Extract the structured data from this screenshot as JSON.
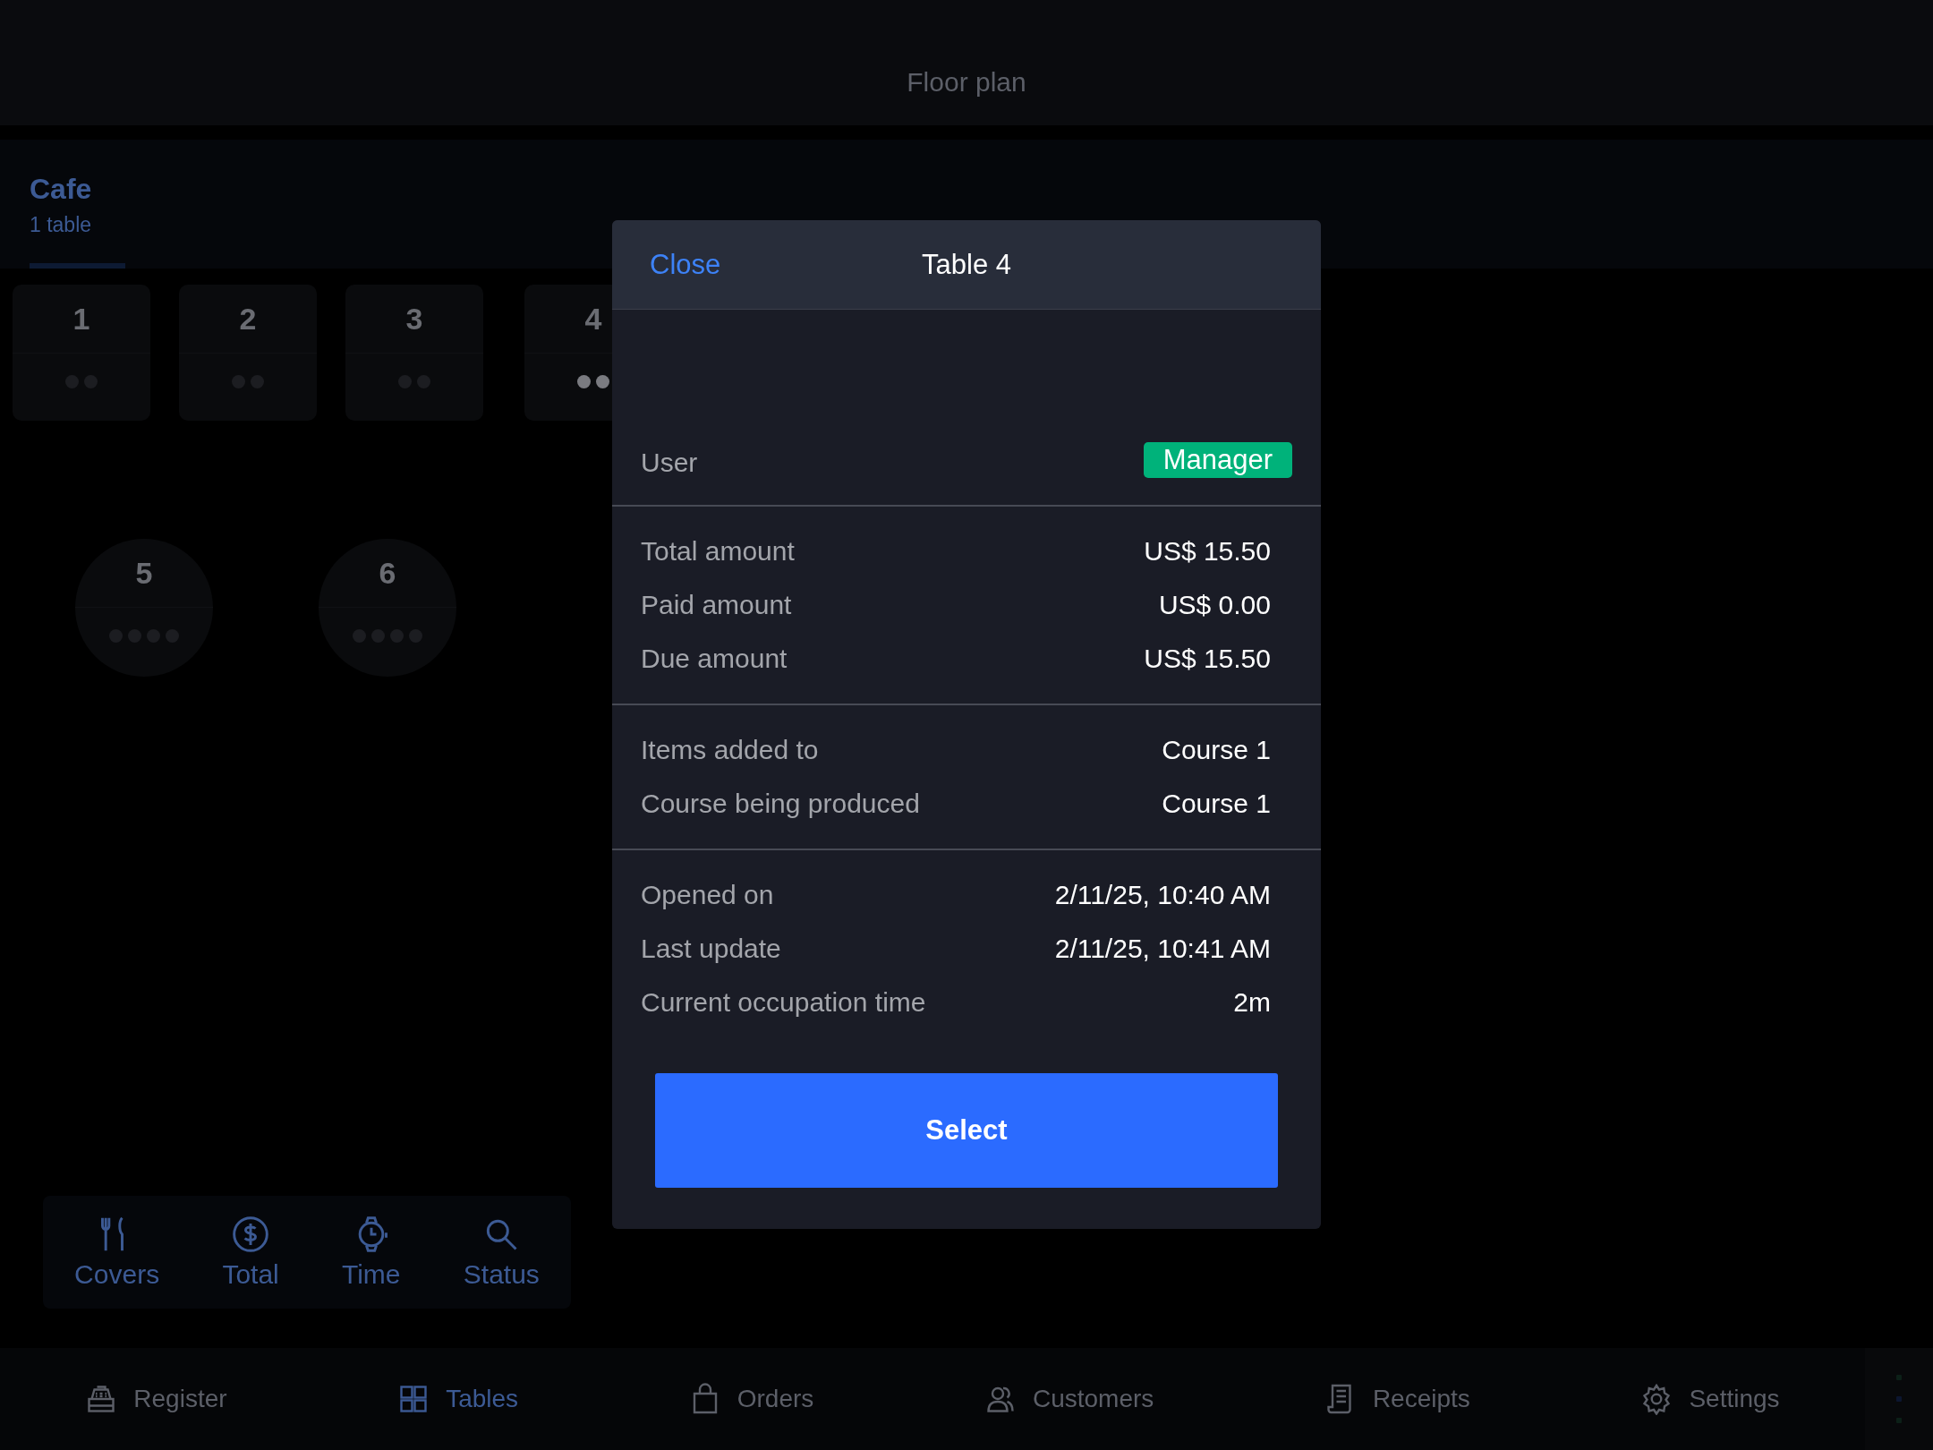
{
  "header": {
    "title": "Floor plan"
  },
  "sections": [
    {
      "name": "Cafe",
      "count": "1 table",
      "selected": true
    }
  ],
  "tables": [
    {
      "number": "1",
      "kind": "square",
      "occupied": false
    },
    {
      "number": "2",
      "kind": "square",
      "occupied": false
    },
    {
      "number": "3",
      "kind": "square",
      "occupied": false
    },
    {
      "number": "4",
      "kind": "square",
      "occupied": true
    },
    {
      "number": "5",
      "kind": "round",
      "occupied": false
    },
    {
      "number": "6",
      "kind": "round",
      "occupied": false
    }
  ],
  "filters": [
    {
      "label": "Covers",
      "kind": "covers"
    },
    {
      "label": "Total",
      "kind": "total"
    },
    {
      "label": "Time",
      "kind": "time"
    },
    {
      "label": "Status",
      "kind": "status"
    }
  ],
  "nav": [
    {
      "label": "Register",
      "kind": "register",
      "selected": false
    },
    {
      "label": "Tables",
      "kind": "tables",
      "selected": true
    },
    {
      "label": "Orders",
      "kind": "orders",
      "selected": false
    },
    {
      "label": "Customers",
      "kind": "customers",
      "selected": false
    },
    {
      "label": "Receipts",
      "kind": "receipts",
      "selected": false
    },
    {
      "label": "Settings",
      "kind": "settings",
      "selected": false
    }
  ],
  "modal": {
    "close": "Close",
    "title": "Table 4",
    "user": {
      "label": "User",
      "value": "Manager"
    },
    "groups": [
      [
        {
          "label": "Total amount",
          "value": "US$ 15.50"
        },
        {
          "label": "Paid amount",
          "value": "US$ 0.00"
        },
        {
          "label": "Due amount",
          "value": "US$ 15.50"
        }
      ],
      [
        {
          "label": "Items added to",
          "value": "Course 1"
        },
        {
          "label": "Course being produced",
          "value": "Course 1"
        }
      ],
      [
        {
          "label": "Opened on",
          "value": "2/11/25, 10:40 AM"
        },
        {
          "label": "Last update",
          "value": "2/11/25, 10:41 AM"
        },
        {
          "label": "Current occupation time",
          "value": "2m"
        }
      ]
    ],
    "button": "Select"
  }
}
